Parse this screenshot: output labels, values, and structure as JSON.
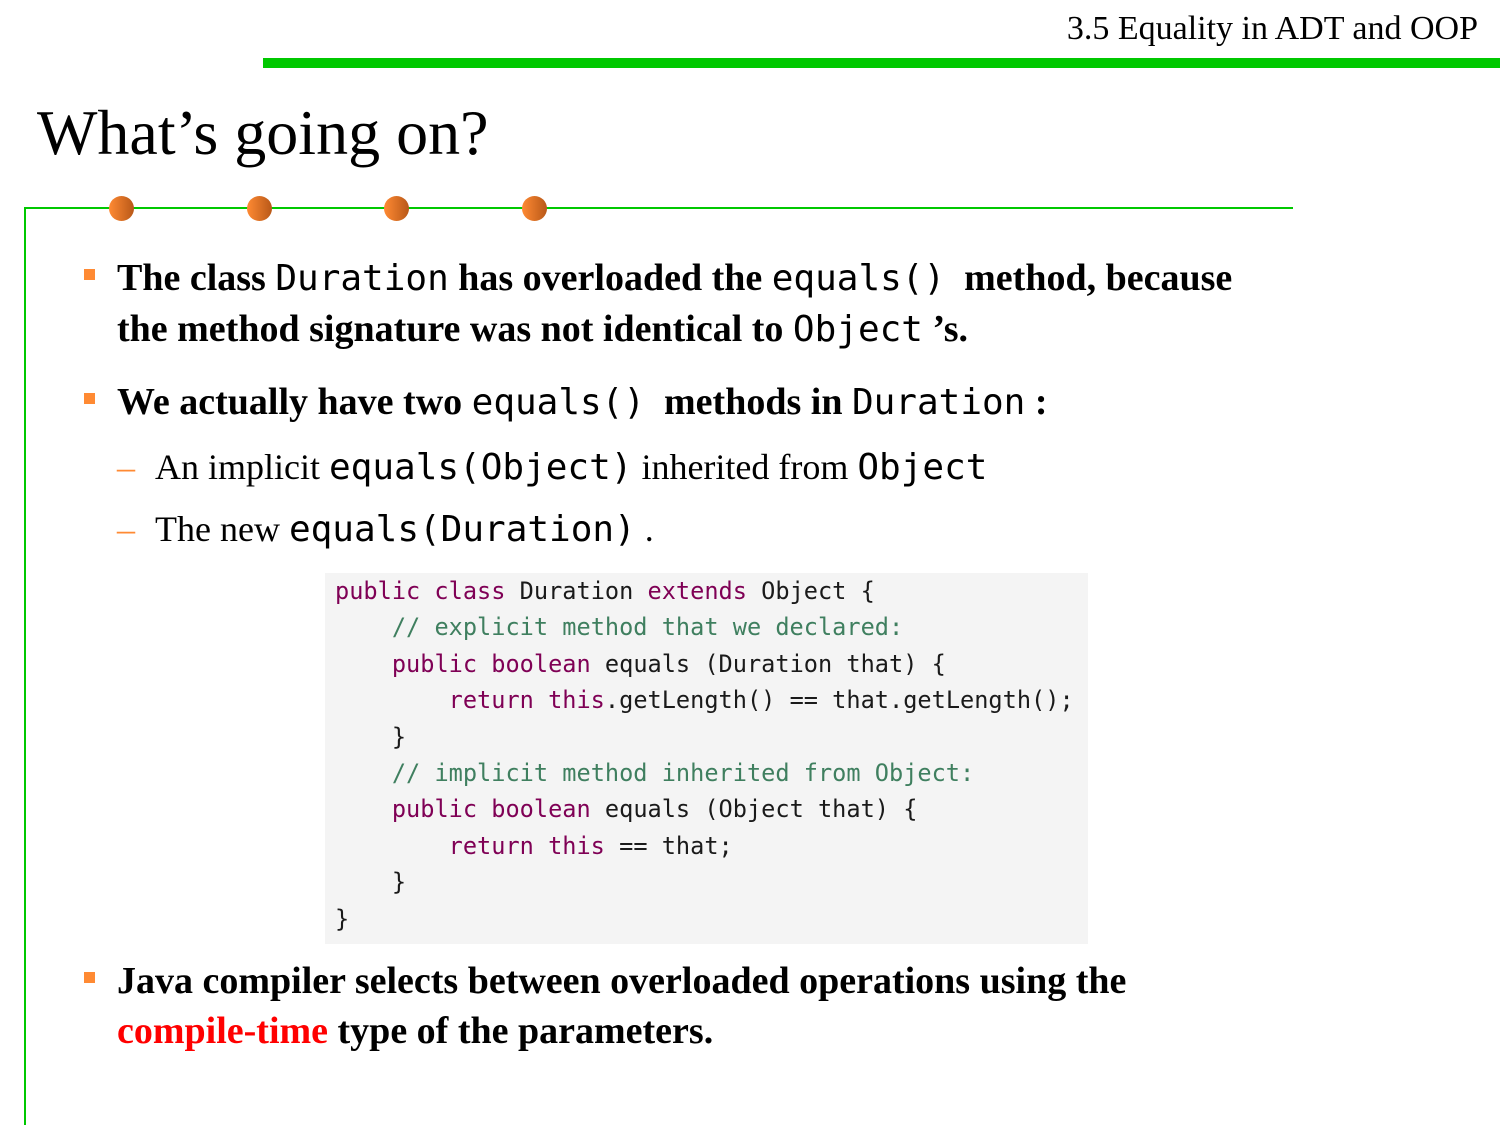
{
  "header": {
    "section": "3.5 Equality in ADT and OOP",
    "accent_color": "#00c800",
    "bullet_color": "#ff8a33"
  },
  "title": "What’s going on?",
  "bullets": [
    {
      "lines": [
        [
          {
            "t": "The class ",
            "s": "b"
          },
          {
            "t": "Duration",
            "s": "m"
          },
          {
            "t": " has overloaded the ",
            "s": "b"
          },
          {
            "t": "equals()",
            "s": "m"
          },
          {
            "t": "  method, because",
            "s": "b"
          }
        ],
        [
          {
            "t": "the method signature was not identical to ",
            "s": "b"
          },
          {
            "t": "Object",
            "s": "m"
          },
          {
            "t": " ’s.",
            "s": "b"
          }
        ]
      ]
    },
    {
      "lines": [
        [
          {
            "t": "We actually have two ",
            "s": "b"
          },
          {
            "t": "equals()",
            "s": "m"
          },
          {
            "t": "  methods in ",
            "s": "b"
          },
          {
            "t": "Duration",
            "s": "m"
          },
          {
            "t": " :",
            "s": "b"
          }
        ]
      ]
    },
    {
      "lines": [
        [
          {
            "t": "Java compiler selects between overloaded operations using the",
            "s": "b"
          }
        ],
        [
          {
            "t": "compile-time",
            "s": "r"
          },
          {
            "t": " type of the parameters.",
            "s": "b"
          }
        ]
      ]
    }
  ],
  "subitems": [
    [
      {
        "t": "An implicit ",
        "s": "n"
      },
      {
        "t": "equals(Object)",
        "s": "m"
      },
      {
        "t": " inherited from ",
        "s": "n"
      },
      {
        "t": "Object",
        "s": "m"
      }
    ],
    [
      {
        "t": "The new ",
        "s": "n"
      },
      {
        "t": "equals(Duration)",
        "s": "m"
      },
      {
        "t": " .",
        "s": "n"
      }
    ]
  ],
  "code": [
    [
      [
        "kw",
        "public class "
      ],
      [
        "pl",
        "Duration "
      ],
      [
        "kw",
        "extends "
      ],
      [
        "pl",
        "Object {"
      ]
    ],
    [
      [
        "pl",
        "    "
      ],
      [
        "cm",
        "// explicit method that we declared:"
      ]
    ],
    [
      [
        "pl",
        "    "
      ],
      [
        "kw",
        "public boolean "
      ],
      [
        "pl",
        "equals (Duration that) {"
      ]
    ],
    [
      [
        "pl",
        "        "
      ],
      [
        "kw",
        "return this"
      ],
      [
        "pl",
        ".getLength() == that.getLength();"
      ]
    ],
    [
      [
        "pl",
        "    }"
      ]
    ],
    [
      [
        "pl",
        "    "
      ],
      [
        "cm",
        "// implicit method inherited from Object:"
      ]
    ],
    [
      [
        "pl",
        "    "
      ],
      [
        "kw",
        "public boolean "
      ],
      [
        "pl",
        "equals (Object that) {"
      ]
    ],
    [
      [
        "pl",
        "        "
      ],
      [
        "kw",
        "return this "
      ],
      [
        "pl",
        "== that;"
      ]
    ],
    [
      [
        "pl",
        "    }"
      ]
    ],
    [
      [
        "pl",
        "}"
      ]
    ]
  ]
}
